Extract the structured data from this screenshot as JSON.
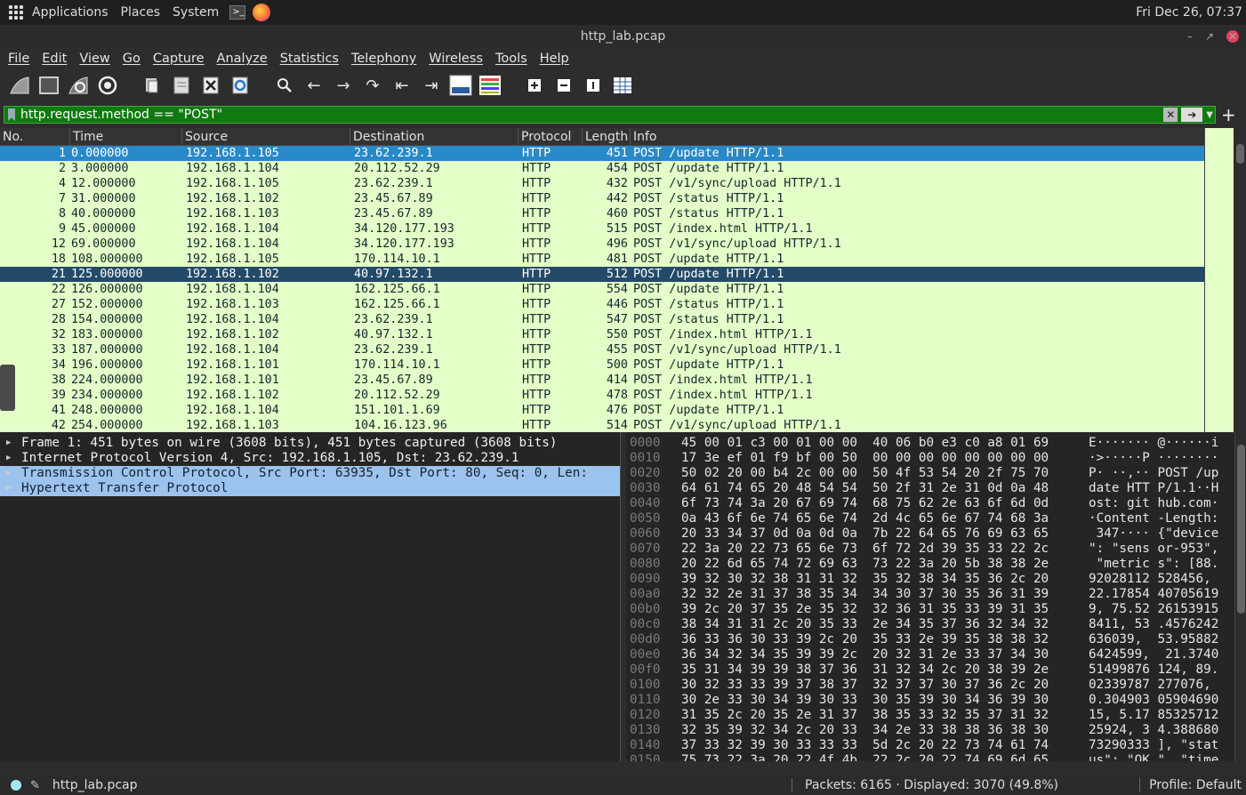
{
  "system": {
    "apps": "Applications",
    "places": "Places",
    "system": "System",
    "clock": "Fri Dec 26, 07:37"
  },
  "window": {
    "title": "http_lab.pcap"
  },
  "menu": [
    "File",
    "Edit",
    "View",
    "Go",
    "Capture",
    "Analyze",
    "Statistics",
    "Telephony",
    "Wireless",
    "Tools",
    "Help"
  ],
  "filter": {
    "value": "http.request.method == \"POST\""
  },
  "columns": {
    "no": "No.",
    "time": "Time",
    "source": "Source",
    "destination": "Destination",
    "protocol": "Protocol",
    "length": "Length",
    "info": "Info"
  },
  "packets": [
    {
      "no": "1",
      "time": "0.000000",
      "src": "192.168.1.105",
      "dst": "23.62.239.1",
      "proto": "HTTP",
      "len": "451",
      "info": "POST /update HTTP/1.1"
    },
    {
      "no": "2",
      "time": "3.000000",
      "src": "192.168.1.104",
      "dst": "20.112.52.29",
      "proto": "HTTP",
      "len": "454",
      "info": "POST /update HTTP/1.1"
    },
    {
      "no": "4",
      "time": "12.000000",
      "src": "192.168.1.105",
      "dst": "23.62.239.1",
      "proto": "HTTP",
      "len": "432",
      "info": "POST /v1/sync/upload HTTP/1.1"
    },
    {
      "no": "7",
      "time": "31.000000",
      "src": "192.168.1.102",
      "dst": "23.45.67.89",
      "proto": "HTTP",
      "len": "442",
      "info": "POST /status HTTP/1.1"
    },
    {
      "no": "8",
      "time": "40.000000",
      "src": "192.168.1.103",
      "dst": "23.45.67.89",
      "proto": "HTTP",
      "len": "460",
      "info": "POST /status HTTP/1.1"
    },
    {
      "no": "9",
      "time": "45.000000",
      "src": "192.168.1.104",
      "dst": "34.120.177.193",
      "proto": "HTTP",
      "len": "515",
      "info": "POST /index.html HTTP/1.1"
    },
    {
      "no": "12",
      "time": "69.000000",
      "src": "192.168.1.104",
      "dst": "34.120.177.193",
      "proto": "HTTP",
      "len": "496",
      "info": "POST /v1/sync/upload HTTP/1.1"
    },
    {
      "no": "18",
      "time": "108.000000",
      "src": "192.168.1.105",
      "dst": "170.114.10.1",
      "proto": "HTTP",
      "len": "481",
      "info": "POST /update HTTP/1.1"
    },
    {
      "no": "21",
      "time": "125.000000",
      "src": "192.168.1.102",
      "dst": "40.97.132.1",
      "proto": "HTTP",
      "len": "512",
      "info": "POST /update HTTP/1.1"
    },
    {
      "no": "22",
      "time": "126.000000",
      "src": "192.168.1.104",
      "dst": "162.125.66.1",
      "proto": "HTTP",
      "len": "554",
      "info": "POST /update HTTP/1.1"
    },
    {
      "no": "27",
      "time": "152.000000",
      "src": "192.168.1.103",
      "dst": "162.125.66.1",
      "proto": "HTTP",
      "len": "446",
      "info": "POST /status HTTP/1.1"
    },
    {
      "no": "28",
      "time": "154.000000",
      "src": "192.168.1.104",
      "dst": "23.62.239.1",
      "proto": "HTTP",
      "len": "547",
      "info": "POST /status HTTP/1.1"
    },
    {
      "no": "32",
      "time": "183.000000",
      "src": "192.168.1.102",
      "dst": "40.97.132.1",
      "proto": "HTTP",
      "len": "550",
      "info": "POST /index.html HTTP/1.1"
    },
    {
      "no": "33",
      "time": "187.000000",
      "src": "192.168.1.104",
      "dst": "23.62.239.1",
      "proto": "HTTP",
      "len": "455",
      "info": "POST /v1/sync/upload HTTP/1.1"
    },
    {
      "no": "34",
      "time": "196.000000",
      "src": "192.168.1.101",
      "dst": "170.114.10.1",
      "proto": "HTTP",
      "len": "500",
      "info": "POST /update HTTP/1.1"
    },
    {
      "no": "38",
      "time": "224.000000",
      "src": "192.168.1.101",
      "dst": "23.45.67.89",
      "proto": "HTTP",
      "len": "414",
      "info": "POST /index.html HTTP/1.1"
    },
    {
      "no": "39",
      "time": "234.000000",
      "src": "192.168.1.102",
      "dst": "20.112.52.29",
      "proto": "HTTP",
      "len": "478",
      "info": "POST /index.html HTTP/1.1"
    },
    {
      "no": "41",
      "time": "248.000000",
      "src": "192.168.1.104",
      "dst": "151.101.1.69",
      "proto": "HTTP",
      "len": "476",
      "info": "POST /update HTTP/1.1"
    },
    {
      "no": "42",
      "time": "254.000000",
      "src": "192.168.1.103",
      "dst": "104.16.123.96",
      "proto": "HTTP",
      "len": "514",
      "info": "POST /v1/sync/upload HTTP/1.1"
    }
  ],
  "details": [
    "Frame 1: 451 bytes on wire (3608 bits), 451 bytes captured (3608 bits)",
    "Internet Protocol Version 4, Src: 192.168.1.105, Dst: 23.62.239.1",
    "Transmission Control Protocol, Src Port: 63935, Dst Port: 80, Seq: 0, Len:",
    "Hypertext Transfer Protocol"
  ],
  "hex": [
    {
      "off": "0000",
      "hex": "45 00 01 c3 00 01 00 00  40 06 b0 e3 c0 a8 01 69",
      "asc": "E······· @······i"
    },
    {
      "off": "0010",
      "hex": "17 3e ef 01 f9 bf 00 50  00 00 00 00 00 00 00 00",
      "asc": "·>·····P ········"
    },
    {
      "off": "0020",
      "hex": "50 02 20 00 b4 2c 00 00  50 4f 53 54 20 2f 75 70",
      "asc": "P· ··,·· POST /up"
    },
    {
      "off": "0030",
      "hex": "64 61 74 65 20 48 54 54  50 2f 31 2e 31 0d 0a 48",
      "asc": "date HTT P/1.1··H"
    },
    {
      "off": "0040",
      "hex": "6f 73 74 3a 20 67 69 74  68 75 62 2e 63 6f 6d 0d",
      "asc": "ost: git hub.com·"
    },
    {
      "off": "0050",
      "hex": "0a 43 6f 6e 74 65 6e 74  2d 4c 65 6e 67 74 68 3a",
      "asc": "·Content -Length:"
    },
    {
      "off": "0060",
      "hex": "20 33 34 37 0d 0a 0d 0a  7b 22 64 65 76 69 63 65",
      "asc": " 347···· {\"device"
    },
    {
      "off": "0070",
      "hex": "22 3a 20 22 73 65 6e 73  6f 72 2d 39 35 33 22 2c",
      "asc": "\": \"sens or-953\","
    },
    {
      "off": "0080",
      "hex": "20 22 6d 65 74 72 69 63  73 22 3a 20 5b 38 38 2e",
      "asc": " \"metric s\": [88."
    },
    {
      "off": "0090",
      "hex": "39 32 30 32 38 31 31 32  35 32 38 34 35 36 2c 20",
      "asc": "92028112 528456, "
    },
    {
      "off": "00a0",
      "hex": "32 32 2e 31 37 38 35 34  34 30 37 30 35 36 31 39",
      "asc": "22.17854 40705619"
    },
    {
      "off": "00b0",
      "hex": "39 2c 20 37 35 2e 35 32  32 36 31 35 33 39 31 35",
      "asc": "9, 75.52 26153915"
    },
    {
      "off": "00c0",
      "hex": "38 34 31 31 2c 20 35 33  2e 34 35 37 36 32 34 32",
      "asc": "8411, 53 .4576242"
    },
    {
      "off": "00d0",
      "hex": "36 33 36 30 33 39 2c 20  35 33 2e 39 35 38 38 32",
      "asc": "636039,  53.95882"
    },
    {
      "off": "00e0",
      "hex": "36 34 32 34 35 39 39 2c  20 32 31 2e 33 37 34 30",
      "asc": "6424599,  21.3740"
    },
    {
      "off": "00f0",
      "hex": "35 31 34 39 39 38 37 36  31 32 34 2c 20 38 39 2e",
      "asc": "51499876 124, 89."
    },
    {
      "off": "0100",
      "hex": "30 32 33 33 39 37 38 37  32 37 37 30 37 36 2c 20",
      "asc": "02339787 277076, "
    },
    {
      "off": "0110",
      "hex": "30 2e 33 30 34 39 30 33  30 35 39 30 34 36 39 30",
      "asc": "0.304903 05904690"
    },
    {
      "off": "0120",
      "hex": "31 35 2c 20 35 2e 31 37  38 35 33 32 35 37 31 32",
      "asc": "15, 5.17 85325712"
    },
    {
      "off": "0130",
      "hex": "32 35 39 32 34 2c 20 33  34 2e 33 38 38 36 38 30",
      "asc": "25924, 3 4.388680"
    },
    {
      "off": "0140",
      "hex": "37 33 32 39 30 33 33 33  5d 2c 20 22 73 74 61 74",
      "asc": "73290333 ], \"stat"
    },
    {
      "off": "0150",
      "hex": "75 73 22 3a 20 22 4f 4b  22 2c 20 22 74 69 6d 65",
      "asc": "us\": \"OK \", \"time"
    }
  ],
  "status": {
    "file": "http_lab.pcap",
    "packets": "Packets: 6165 · Displayed: 3070 (49.8%)",
    "profile": "Profile: Default"
  },
  "colors": {
    "row_bg": "#e4ffc7",
    "selected": "#2889c8",
    "selected_secondary": "#234a68",
    "filter_ok": "#107a10"
  }
}
